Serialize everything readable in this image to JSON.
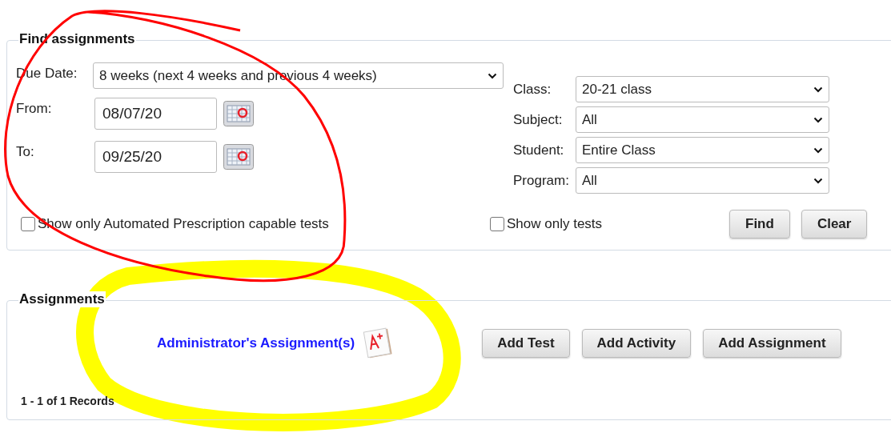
{
  "find_assignments": {
    "legend": "Find assignments",
    "due_date": {
      "label": "Due Date:",
      "value": "8 weeks (next 4 weeks and previous 4 weeks)"
    },
    "dates": [
      {
        "label": "From:",
        "value": "08/07/20"
      },
      {
        "label": "To:",
        "value": "09/25/20"
      }
    ],
    "filters": [
      {
        "label": "Class:",
        "value": "20-21 class"
      },
      {
        "label": "Subject:",
        "value": "All"
      },
      {
        "label": "Student:",
        "value": "Entire Class"
      },
      {
        "label": "Program:",
        "value": "All"
      }
    ],
    "checkboxes": [
      {
        "label": "Show only Automated Prescription capable tests",
        "checked": false
      },
      {
        "label": "Show only tests",
        "checked": false
      }
    ],
    "buttons": [
      "Find",
      "Clear"
    ]
  },
  "assignments": {
    "legend": "Assignments",
    "link": "Administrator's Assignment(s)",
    "buttons": [
      "Add Test",
      "Add Activity",
      "Add Assignment"
    ],
    "records": "1 - 1 of 1 Records"
  }
}
